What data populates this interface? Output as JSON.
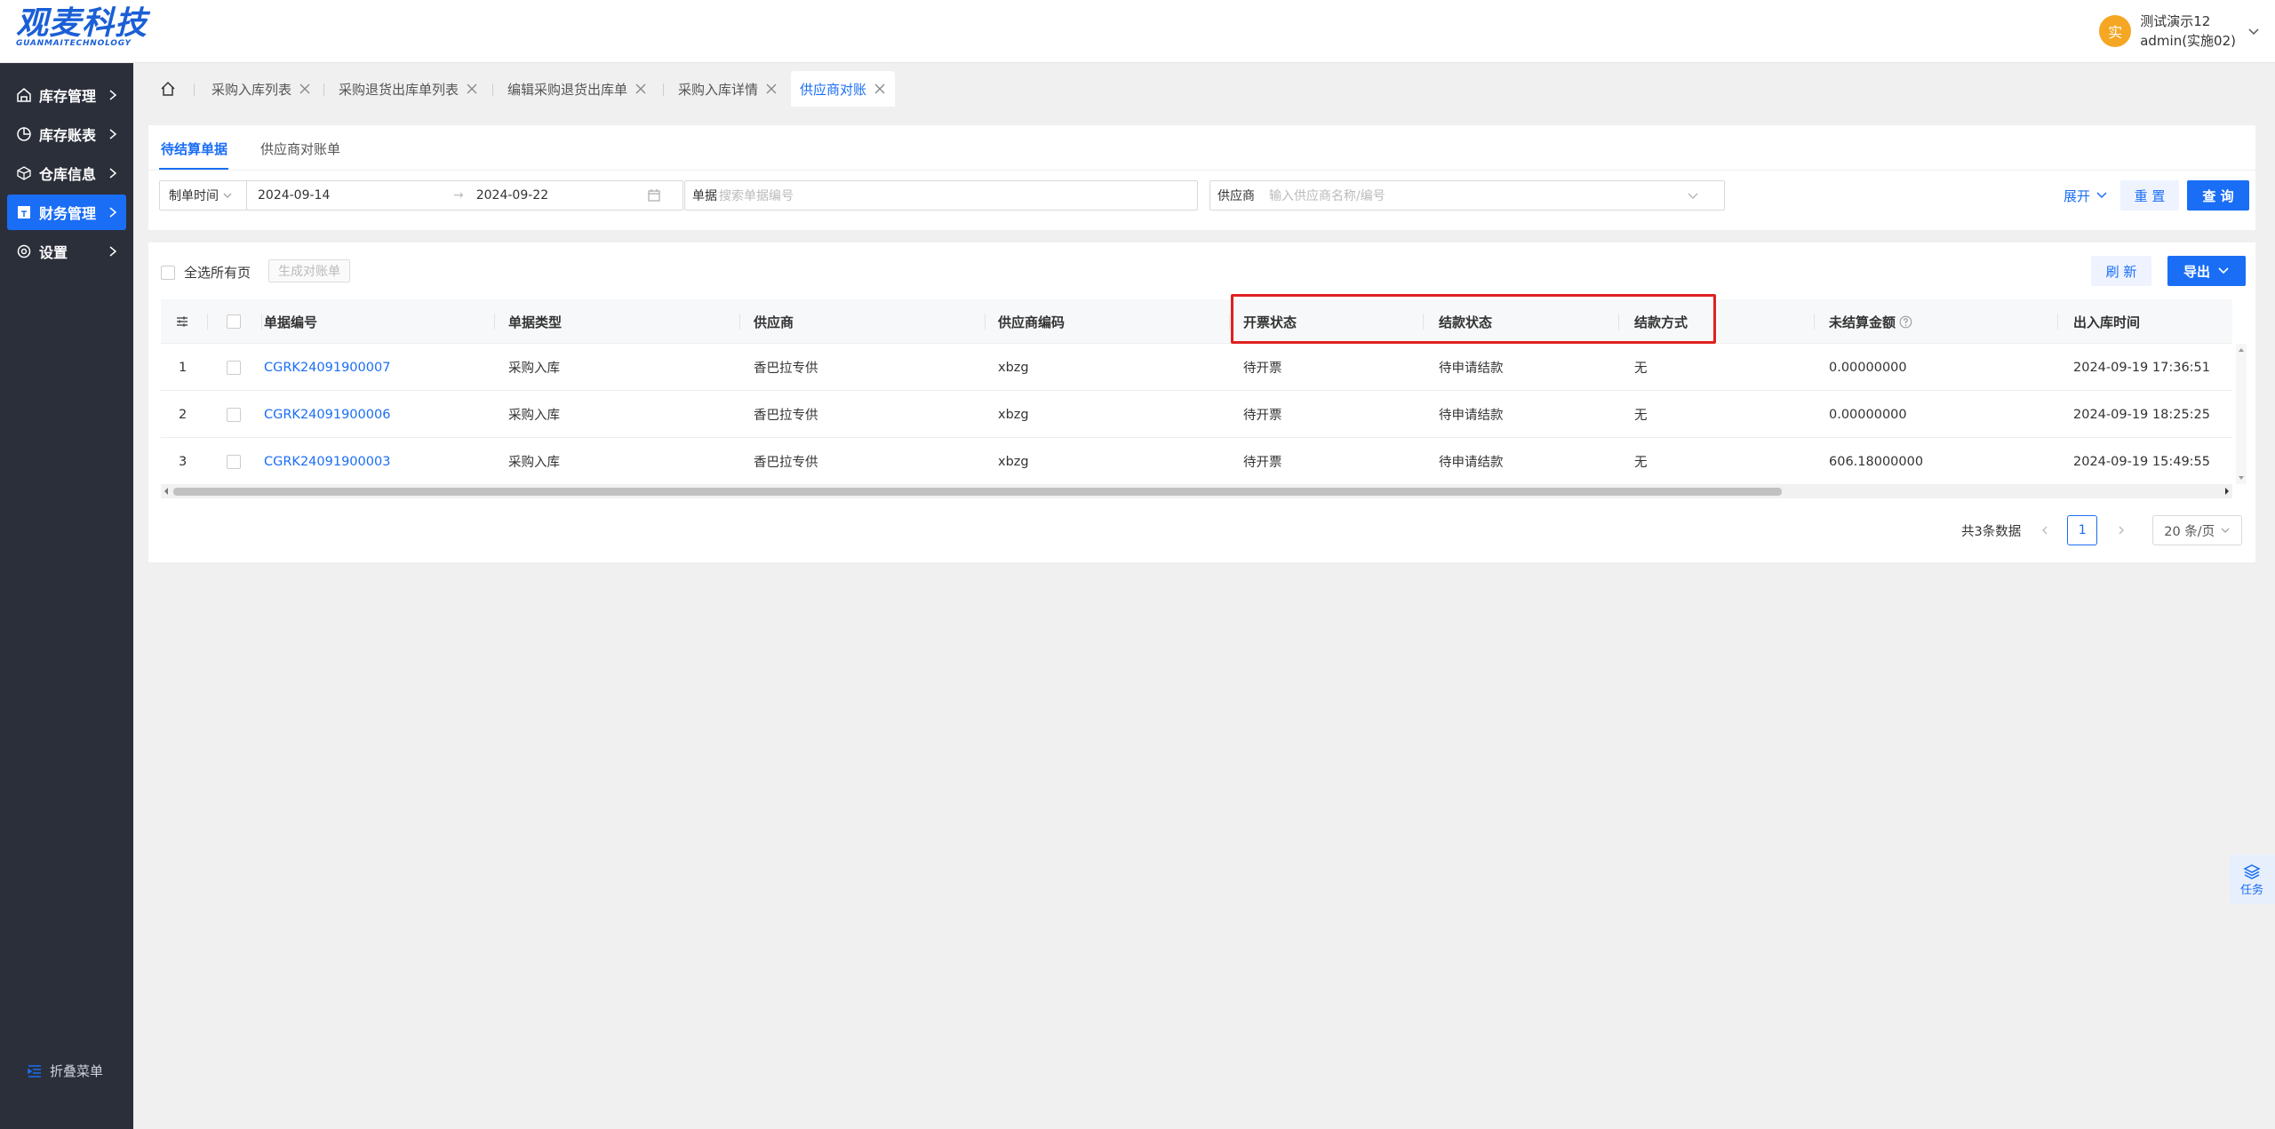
{
  "logo": {
    "cn": "观麦科技",
    "en": "GUANMAITECHNOLOGY"
  },
  "user": {
    "avatar_char": "实",
    "name": "测试演示12",
    "account": "admin(实施02)"
  },
  "sidebar": {
    "items": [
      {
        "label": "库存管理",
        "icon": "warehouse-icon"
      },
      {
        "label": "库存账表",
        "icon": "pie-chart-icon"
      },
      {
        "label": "仓库信息",
        "icon": "cube-icon"
      },
      {
        "label": "财务管理",
        "icon": "finance-icon",
        "active": true
      },
      {
        "label": "设置",
        "icon": "gear-icon"
      }
    ],
    "collapse_label": "折叠菜单"
  },
  "tabs": [
    {
      "label": "采购入库列表"
    },
    {
      "label": "采购退货出库单列表"
    },
    {
      "label": "编辑采购退货出库单"
    },
    {
      "label": "采购入库详情"
    },
    {
      "label": "供应商对账",
      "active": true
    }
  ],
  "subtabs": [
    "待结算单据",
    "供应商对账单"
  ],
  "filters": {
    "date_type": "制单时间",
    "date_start": "2024-09-14",
    "date_sep": "→",
    "date_end": "2024-09-22",
    "doc_label": "单据",
    "doc_placeholder": "搜索单据编号",
    "supplier_label": "供应商",
    "supplier_placeholder": "输入供应商名称/编号",
    "expand_label": "展开",
    "reset_label": "重 置",
    "query_label": "查 询"
  },
  "toolbar": {
    "select_all_label": "全选所有页",
    "generate_label": "生成对账单",
    "refresh_label": "刷 新",
    "export_label": "导出"
  },
  "table": {
    "columns": [
      "单据编号",
      "单据类型",
      "供应商",
      "供应商编码",
      "开票状态",
      "结款状态",
      "结款方式",
      "未结算金额",
      "出入库时间"
    ],
    "rows": [
      {
        "idx": "1",
        "code": "CGRK24091900007",
        "type": "采购入库",
        "supplier": "香巴拉专供",
        "supplier_code": "xbzg",
        "invoice": "待开票",
        "pay_status": "待申请结款",
        "pay_method": "无",
        "amount": "0.00000000",
        "time": "2024-09-19 17:36:51"
      },
      {
        "idx": "2",
        "code": "CGRK24091900006",
        "type": "采购入库",
        "supplier": "香巴拉专供",
        "supplier_code": "xbzg",
        "invoice": "待开票",
        "pay_status": "待申请结款",
        "pay_method": "无",
        "amount": "0.00000000",
        "time": "2024-09-19 18:25:25"
      },
      {
        "idx": "3",
        "code": "CGRK24091900003",
        "type": "采购入库",
        "supplier": "香巴拉专供",
        "supplier_code": "xbzg",
        "invoice": "待开票",
        "pay_status": "待申请结款",
        "pay_method": "无",
        "amount": "606.18000000",
        "time": "2024-09-19 15:49:55"
      }
    ]
  },
  "pagination": {
    "total_label": "共3条数据",
    "current": "1",
    "page_size": "20 条/页"
  },
  "task_float": {
    "label": "任务"
  },
  "colors": {
    "primary": "#1a6ef5",
    "sidebar_bg": "#2b2f3a",
    "highlight": "#e02020"
  }
}
